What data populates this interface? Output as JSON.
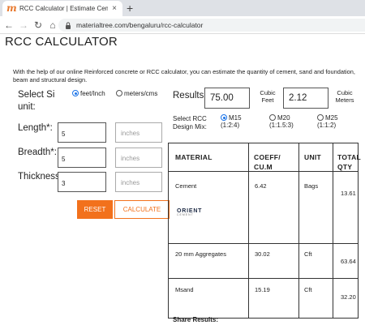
{
  "browser": {
    "tab_title": "RCC Calculator | Estimate Cement",
    "tab_close": "×",
    "new_tab": "+",
    "url": "materialtree.com/bengaluru/rcc-calculator"
  },
  "page": {
    "title": "RCC CALCULATOR",
    "intro": "With the help of our online Reinforced concrete or RCC calculator, you can estimate the quantity of cement, sand and foundation, beam and structural design."
  },
  "form": {
    "si_label": "Select Si unit:",
    "unit_option_1": "feet/Inch",
    "unit_option_2": "meters/cms",
    "length_label": "Length*:",
    "length_value": "5",
    "breadth_label": "Breadth*:",
    "breadth_value": "5",
    "thickness_label": "Thickness",
    "thickness_value": "3",
    "inches_placeholder": "inches",
    "reset_label": "RESET",
    "calculate_label": "CALCULATE"
  },
  "results": {
    "label": "Results",
    "cubic_feet_value": "75.00",
    "cubic_feet_unit": "Cubic Feet",
    "cubic_meters_value": "2.12",
    "cubic_meters_unit": "Cubic Meters",
    "grade_label": "Select RCC Design Mix:",
    "grades": [
      {
        "name": "M15",
        "ratio": "(1:2:4)"
      },
      {
        "name": "M20",
        "ratio": "(1:1.5:3)"
      },
      {
        "name": "M25",
        "ratio": "(1:1:2)"
      }
    ]
  },
  "table": {
    "headers": [
      "MATERIAL",
      "COEFF/ CU.M",
      "UNIT",
      "TOTAL QTY"
    ],
    "rows": [
      {
        "material": "Cement",
        "coeff": "6.42",
        "unit": "Bags",
        "total": "13.61"
      },
      {
        "material": "20 mm Aggregates",
        "coeff": "30.02",
        "unit": "Cft",
        "total": "63.64"
      },
      {
        "material": "Msand",
        "coeff": "15.19",
        "unit": "Cft",
        "total": "32.20"
      }
    ],
    "brand": "ORIENT",
    "brand_sub": "CEMENT"
  },
  "share_label": "Share Results:"
}
